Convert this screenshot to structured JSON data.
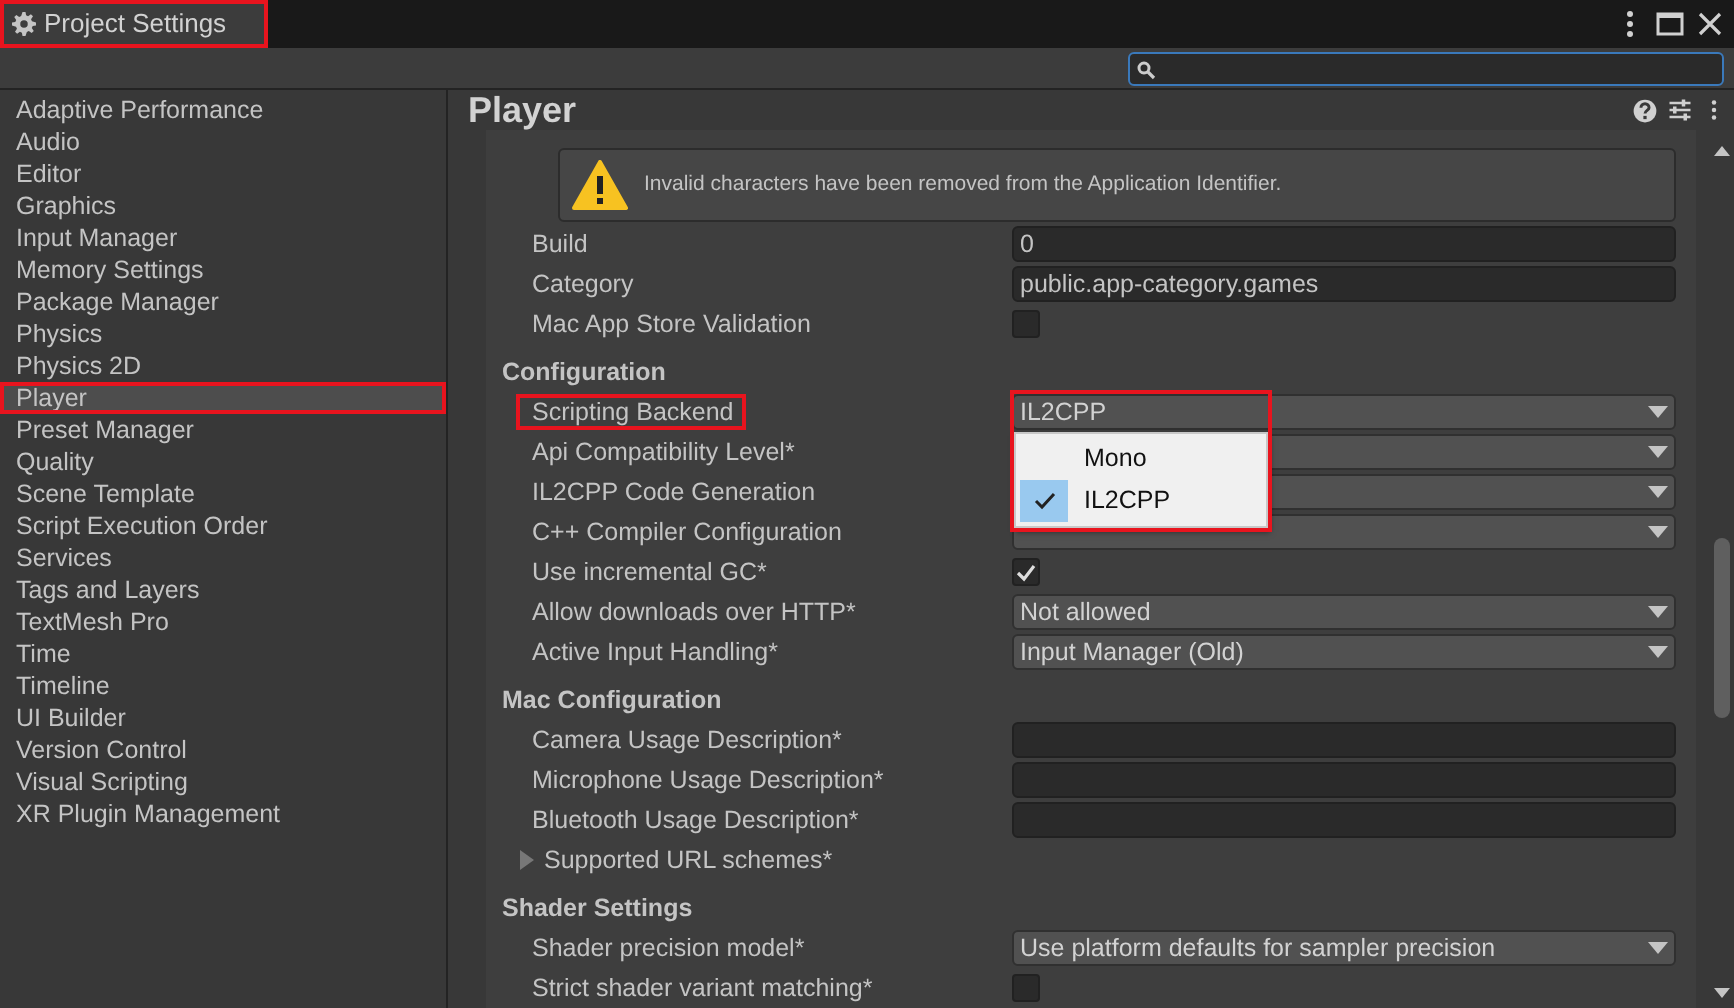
{
  "window": {
    "title": "Project Settings",
    "highlighted": true
  },
  "search": {
    "focused": true
  },
  "sidebar": {
    "items": [
      {
        "label": "Adaptive Performance",
        "selected": false,
        "highlighted": false
      },
      {
        "label": "Audio",
        "selected": false,
        "highlighted": false
      },
      {
        "label": "Editor",
        "selected": false,
        "highlighted": false
      },
      {
        "label": "Graphics",
        "selected": false,
        "highlighted": false
      },
      {
        "label": "Input Manager",
        "selected": false,
        "highlighted": false
      },
      {
        "label": "Memory Settings",
        "selected": false,
        "highlighted": false
      },
      {
        "label": "Package Manager",
        "selected": false,
        "highlighted": false
      },
      {
        "label": "Physics",
        "selected": false,
        "highlighted": false
      },
      {
        "label": "Physics 2D",
        "selected": false,
        "highlighted": false
      },
      {
        "label": "Player",
        "selected": true,
        "highlighted": true
      },
      {
        "label": "Preset Manager",
        "selected": false,
        "highlighted": false
      },
      {
        "label": "Quality",
        "selected": false,
        "highlighted": false
      },
      {
        "label": "Scene Template",
        "selected": false,
        "highlighted": false
      },
      {
        "label": "Script Execution Order",
        "selected": false,
        "highlighted": false
      },
      {
        "label": "Services",
        "selected": false,
        "highlighted": false
      },
      {
        "label": "Tags and Layers",
        "selected": false,
        "highlighted": false
      },
      {
        "label": "TextMesh Pro",
        "selected": false,
        "highlighted": false
      },
      {
        "label": "Time",
        "selected": false,
        "highlighted": false
      },
      {
        "label": "Timeline",
        "selected": false,
        "highlighted": false
      },
      {
        "label": "UI Builder",
        "selected": false,
        "highlighted": false
      },
      {
        "label": "Version Control",
        "selected": false,
        "highlighted": false
      },
      {
        "label": "Visual Scripting",
        "selected": false,
        "highlighted": false
      },
      {
        "label": "XR Plugin Management",
        "selected": false,
        "highlighted": false
      }
    ]
  },
  "content": {
    "title": "Player",
    "notice": "Invalid characters have been removed from the Application Identifier.",
    "rows": [
      {
        "kind": "text",
        "label": "Build",
        "value": "0"
      },
      {
        "kind": "text",
        "label": "Category",
        "value": "public.app-category.games"
      },
      {
        "kind": "checkbox",
        "label": "Mac App Store Validation",
        "checked": false
      },
      {
        "kind": "header",
        "label": "Configuration"
      },
      {
        "kind": "dropdown",
        "label": "Scripting Backend",
        "value": "IL2CPP",
        "highlighted": true,
        "options": [
          {
            "label": "Mono",
            "selected": false
          },
          {
            "label": "IL2CPP",
            "selected": true
          }
        ]
      },
      {
        "kind": "dropdown",
        "label": "Api Compatibility Level*",
        "value": ""
      },
      {
        "kind": "dropdown",
        "label": "IL2CPP Code Generation",
        "value": ""
      },
      {
        "kind": "dropdown",
        "label": "C++ Compiler Configuration",
        "value": ""
      },
      {
        "kind": "checkbox",
        "label": "Use incremental GC*",
        "checked": true
      },
      {
        "kind": "dropdown",
        "label": "Allow downloads over HTTP*",
        "value": "Not allowed"
      },
      {
        "kind": "dropdown",
        "label": "Active Input Handling*",
        "value": "Input Manager (Old)"
      },
      {
        "kind": "header",
        "label": "Mac Configuration"
      },
      {
        "kind": "text",
        "label": "Camera Usage Description*",
        "value": ""
      },
      {
        "kind": "text",
        "label": "Microphone Usage Description*",
        "value": ""
      },
      {
        "kind": "text",
        "label": "Bluetooth Usage Description*",
        "value": ""
      },
      {
        "kind": "foldout",
        "label": "Supported URL schemes*",
        "expanded": false
      },
      {
        "kind": "header",
        "label": "Shader Settings"
      },
      {
        "kind": "dropdown",
        "label": "Shader precision model*",
        "value": "Use platform defaults for sampler precision"
      },
      {
        "kind": "checkbox",
        "label": "Strict shader variant matching*",
        "checked": false
      }
    ]
  }
}
